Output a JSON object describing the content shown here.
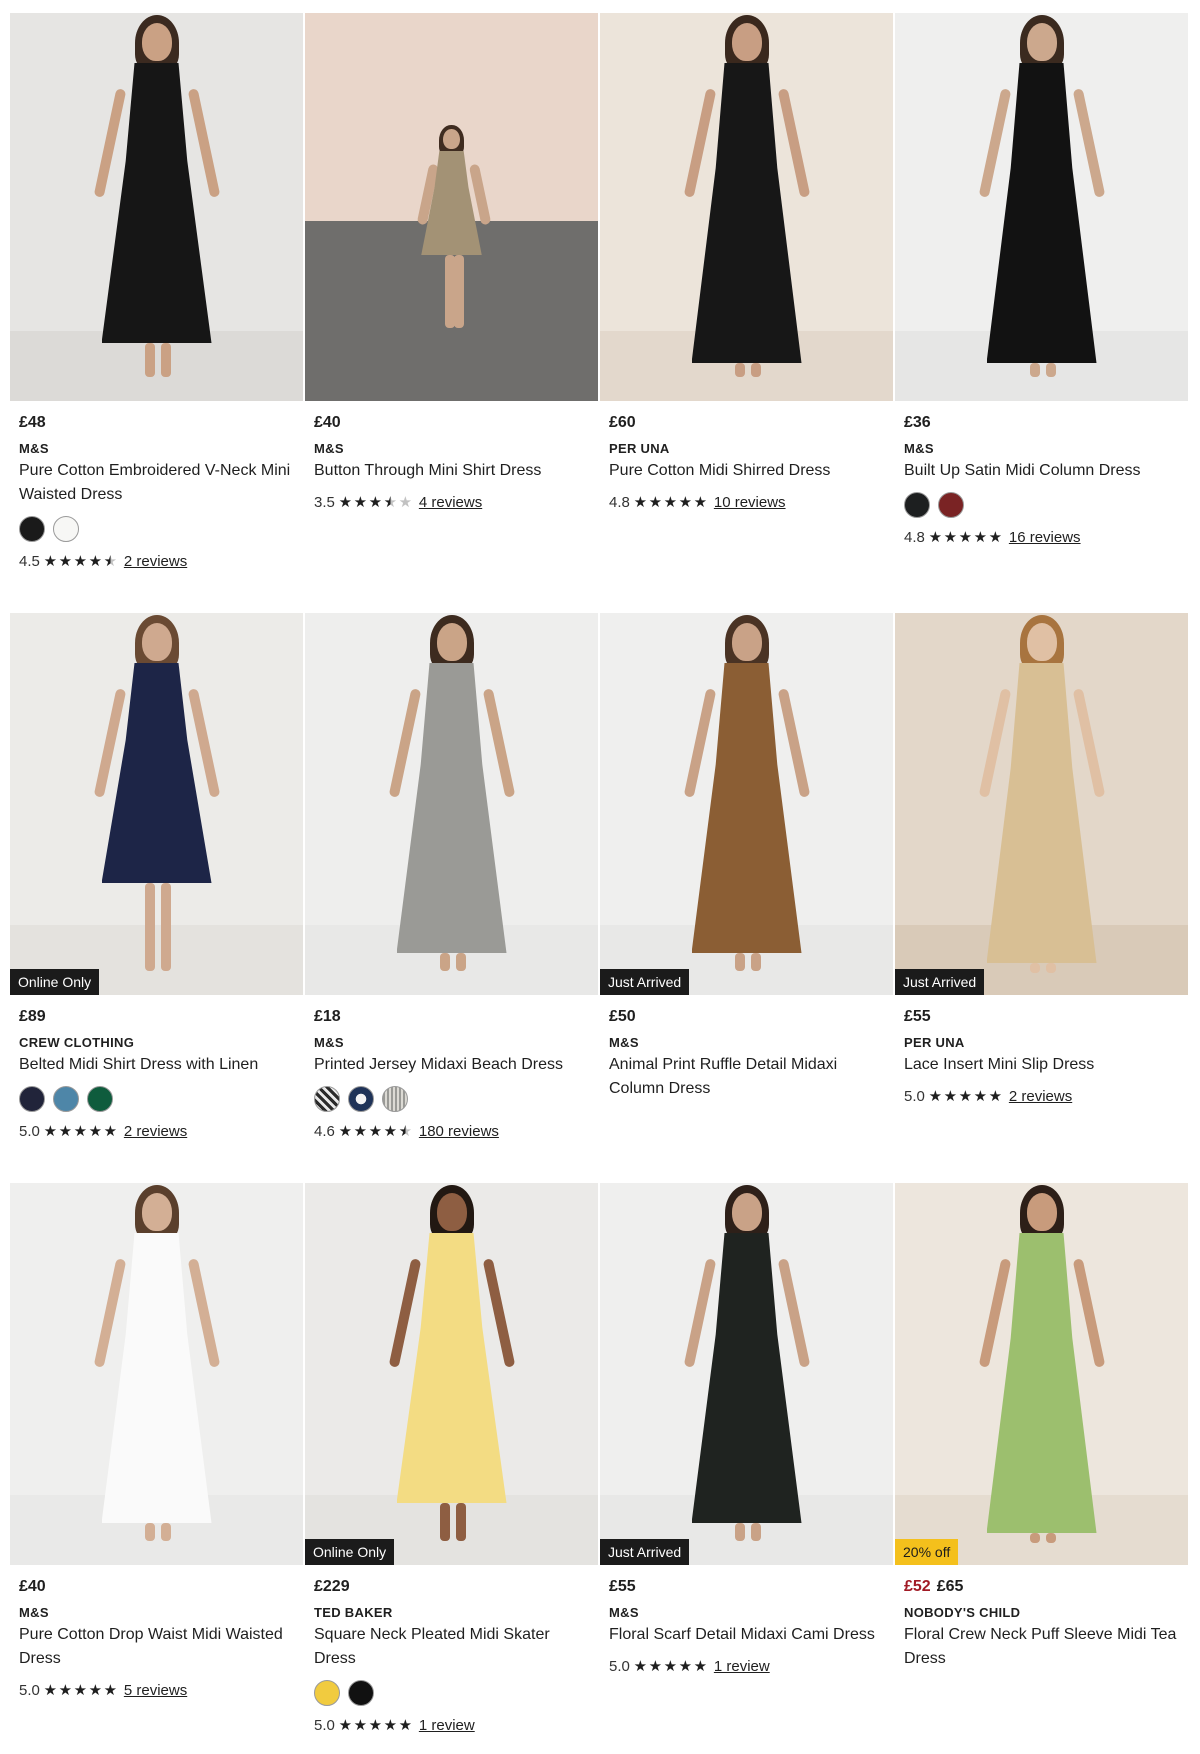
{
  "products": [
    {
      "price": "£48",
      "brand": "M&S",
      "name": "Pure Cotton Embroidered V-Neck Mini Waisted Dress",
      "badge": "",
      "swatches": [
        "#1a1a1a",
        "#f7f7f5"
      ],
      "rating": "4.5",
      "reviews": "2 reviews",
      "stars": [
        "full",
        "full",
        "full",
        "full",
        "half"
      ],
      "scene": {
        "bg": "#e6e5e3",
        "floor": "#dcdad7",
        "dress": "#161616",
        "hair": "#3b2a20",
        "skin": "#caa184"
      }
    },
    {
      "price": "£40",
      "brand": "M&S",
      "name": "Button Through Mini Shirt Dress",
      "badge": "",
      "swatches": [],
      "rating": "3.5",
      "reviews": "4 reviews",
      "stars": [
        "full",
        "full",
        "full",
        "half",
        "empty"
      ],
      "scene": {
        "bg": "#e9d6ca",
        "floor": "#6f6e6c",
        "dress": "#a39275",
        "hair": "#3f2c20",
        "skin": "#c9a58a"
      }
    },
    {
      "price": "£60",
      "brand": "PER UNA",
      "name": "Pure Cotton Midi Shirred Dress",
      "badge": "",
      "swatches": [],
      "rating": "4.8",
      "reviews": "10 reviews",
      "stars": [
        "full",
        "full",
        "full",
        "full",
        "full"
      ],
      "scene": {
        "bg": "#ece4da",
        "floor": "#e3d8cc",
        "dress": "#171717",
        "hair": "#3a281d",
        "skin": "#c89e83"
      }
    },
    {
      "price": "£36",
      "brand": "M&S",
      "name": "Built Up Satin Midi Column Dress",
      "badge": "",
      "swatches": [
        "#1d1f20",
        "#7a2324"
      ],
      "rating": "4.8",
      "reviews": "16 reviews",
      "stars": [
        "full",
        "full",
        "full",
        "full",
        "full"
      ],
      "scene": {
        "bg": "#efefee",
        "floor": "#e6e6e5",
        "dress": "#121212",
        "hair": "#3b2a1f",
        "skin": "#cca88d"
      }
    },
    {
      "price": "£89",
      "brand": "CREW CLOTHING",
      "name": "Belted Midi Shirt Dress with Linen",
      "badge": "Online Only",
      "swatches": [
        "#21243a",
        "#4e86a8",
        "#0f5c3d"
      ],
      "rating": "5.0",
      "reviews": "2 reviews",
      "stars": [
        "full",
        "full",
        "full",
        "full",
        "full"
      ],
      "scene": {
        "bg": "#ecebe8",
        "floor": "#e4e2de",
        "dress": "#1d2547",
        "hair": "#6a4a33",
        "skin": "#cfa98f"
      }
    },
    {
      "price": "£18",
      "brand": "M&S",
      "name": "Printed Jersey Midaxi Beach Dress",
      "badge": "",
      "swatches": [
        "#8c8c8c",
        "#1f3358",
        "#bdbab3"
      ],
      "rating": "4.6",
      "reviews": "180 reviews",
      "stars": [
        "full",
        "full",
        "full",
        "full",
        "half"
      ],
      "scene": {
        "bg": "#eeeeed",
        "floor": "#e8e8e7",
        "dress": "#9a9a96",
        "hair": "#3d2b1f",
        "skin": "#caa487"
      }
    },
    {
      "price": "£50",
      "brand": "M&S",
      "name": "Animal Print Ruffle Detail Midaxi Column Dress",
      "badge": "Just Arrived",
      "swatches": [],
      "rating": "",
      "reviews": "",
      "stars": [],
      "scene": {
        "bg": "#efefee",
        "floor": "#e8e8e7",
        "dress": "#8b5e34",
        "hair": "#4a3324",
        "skin": "#c9a287"
      }
    },
    {
      "price": "£55",
      "brand": "PER UNA",
      "name": "Lace Insert Mini Slip Dress",
      "badge": "Just Arrived",
      "swatches": [],
      "rating": "5.0",
      "reviews": "2 reviews",
      "stars": [
        "full",
        "full",
        "full",
        "full",
        "full"
      ],
      "scene": {
        "bg": "#e3d7c9",
        "floor": "#d9cab8",
        "dress": "#d8bf94",
        "hair": "#a8743f",
        "skin": "#e0c0a4"
      }
    },
    {
      "price": "£40",
      "brand": "M&S",
      "name": "Pure Cotton Drop Waist Midi Waisted Dress",
      "badge": "",
      "swatches": [],
      "rating": "5.0",
      "reviews": "5 reviews",
      "stars": [
        "full",
        "full",
        "full",
        "full",
        "full"
      ],
      "scene": {
        "bg": "#efefee",
        "floor": "#e9e9e8",
        "dress": "#fafafa",
        "hair": "#5a3f2c",
        "skin": "#d3af95"
      }
    },
    {
      "price": "£229",
      "brand": "TED BAKER",
      "name": "Square Neck Pleated Midi Skater Dress",
      "badge": "Online Only",
      "swatches": [
        "#f1cb3f",
        "#111111"
      ],
      "rating": "5.0",
      "reviews": "1 review",
      "stars": [
        "full",
        "full",
        "full",
        "full",
        "full"
      ],
      "scene": {
        "bg": "#ebeae8",
        "floor": "#e4e3e0",
        "dress": "#f3dc83",
        "hair": "#221812",
        "skin": "#8e5e42"
      }
    },
    {
      "price": "£55",
      "brand": "M&S",
      "name": "Floral Scarf Detail Midaxi Cami Dress",
      "badge": "Just Arrived",
      "swatches": [],
      "rating": "5.0",
      "reviews": "1 review",
      "stars": [
        "full",
        "full",
        "full",
        "full",
        "full"
      ],
      "scene": {
        "bg": "#efefee",
        "floor": "#e8e8e7",
        "dress": "#1f2320",
        "hair": "#2e2019",
        "skin": "#c9a287"
      }
    },
    {
      "price": "£65",
      "sale_price": "£52",
      "brand": "NOBODY'S CHILD",
      "name": "Floral Crew Neck Puff Sleeve Midi Tea Dress",
      "badge": "20% off",
      "swatches": [],
      "rating": "",
      "reviews": "",
      "stars": [],
      "scene": {
        "bg": "#ede6dd",
        "floor": "#e5dcd0",
        "dress": "#9cbf6e",
        "hair": "#2d1f18",
        "skin": "#c89b7c"
      }
    }
  ]
}
